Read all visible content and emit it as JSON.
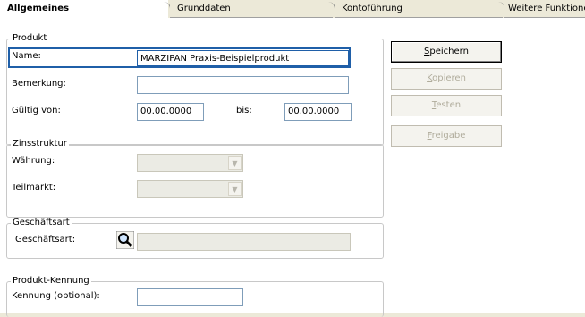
{
  "tabs": [
    {
      "label": "Allgemeines",
      "active": true
    },
    {
      "label": "Grunddaten",
      "active": false
    },
    {
      "label": "Kontoführung",
      "active": false
    },
    {
      "label": "Weitere Funktione",
      "active": false
    }
  ],
  "groups": {
    "produkt": {
      "legend": "Produkt",
      "name_label": "Name:",
      "name_value": "MARZIPAN Praxis-Beispielprodukt",
      "bemerkung_label": "Bemerkung:",
      "bemerkung_value": "",
      "gueltig_label": "Gültig von:",
      "gueltig_von": "00.00.0000",
      "bis_label": "bis:",
      "gueltig_bis": "00.00.0000"
    },
    "zinsstruktur": {
      "legend": "Zinsstruktur",
      "waehrung_label": "Währung:",
      "teilmarkt_label": "Teilmarkt:"
    },
    "geschaeftsart": {
      "legend": "Geschäftsart",
      "label": "Geschäftsart:",
      "value": ""
    },
    "kennung": {
      "legend": "Produkt-Kennung",
      "label": "Kennung (optional):",
      "value": ""
    }
  },
  "buttons": {
    "speichern": {
      "prefix": "",
      "mnemonic": "S",
      "rest": "peichern"
    },
    "kopieren": {
      "prefix": "",
      "mnemonic": "K",
      "rest": "opieren"
    },
    "testen": {
      "prefix": "",
      "mnemonic": "T",
      "rest": "esten"
    },
    "freigabe": {
      "prefix": "",
      "mnemonic": "F",
      "rest": "reigabe"
    }
  },
  "colors": {
    "focus_border": "#1f5fa8",
    "window_bg": "#ece9d8",
    "panel_bg": "#ffffff"
  },
  "icons": {
    "geschaeftsart_lookup": "magnifier-icon"
  }
}
